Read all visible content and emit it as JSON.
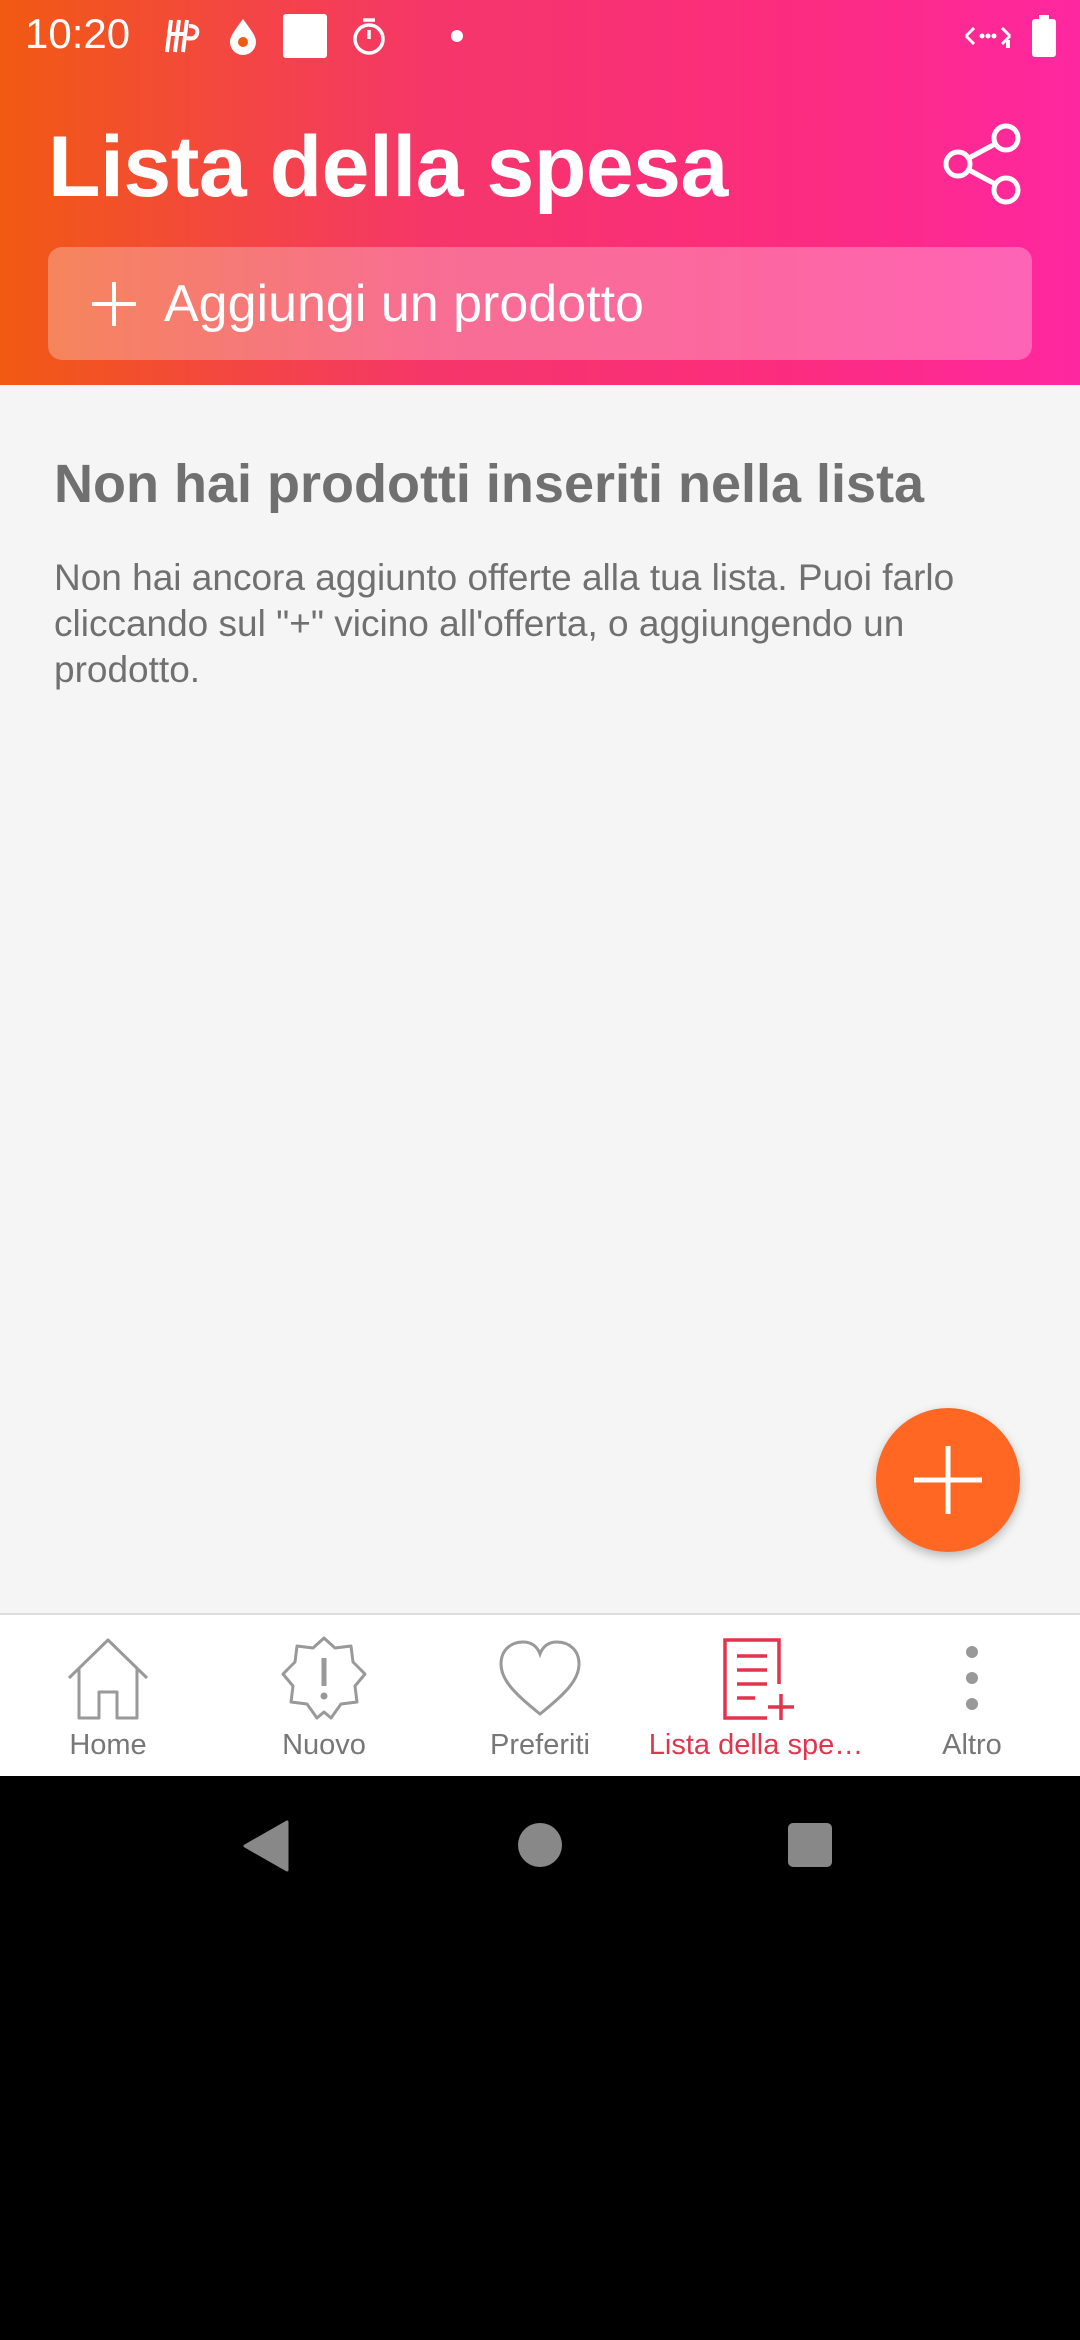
{
  "status_bar": {
    "time": "10:20",
    "left_icons": [
      "hp-icon",
      "drop-icon",
      "square-notification-icon",
      "timer-icon",
      "dot-icon"
    ],
    "right_icons": [
      "data-arrows-icon",
      "battery-icon"
    ]
  },
  "header": {
    "title": "Lista della spesa",
    "share_icon": "share-icon",
    "add_product_label": "Aggiungi un prodotto"
  },
  "empty_state": {
    "title": "Non hai prodotti inseriti nella lista",
    "description": "Non hai ancora aggiunto offerte alla tua lista. Puoi farlo cliccando sul \"+\" vicino all'offerta, o aggiungendo un prodotto."
  },
  "fab": {
    "icon": "plus-icon"
  },
  "bottom_nav": {
    "items": [
      {
        "label": "Home",
        "icon": "home-icon"
      },
      {
        "label": "Nuovo",
        "icon": "new-badge-icon"
      },
      {
        "label": "Preferiti",
        "icon": "heart-icon"
      },
      {
        "label": "Lista della spe…",
        "icon": "list-add-icon",
        "active": true
      },
      {
        "label": "Altro",
        "icon": "more-vertical-icon"
      }
    ]
  },
  "colors": {
    "accent": "#ff6722",
    "active_nav": "#e2344d",
    "header_gradient_start": "#f15a12",
    "header_gradient_end": "#ff27a0"
  }
}
